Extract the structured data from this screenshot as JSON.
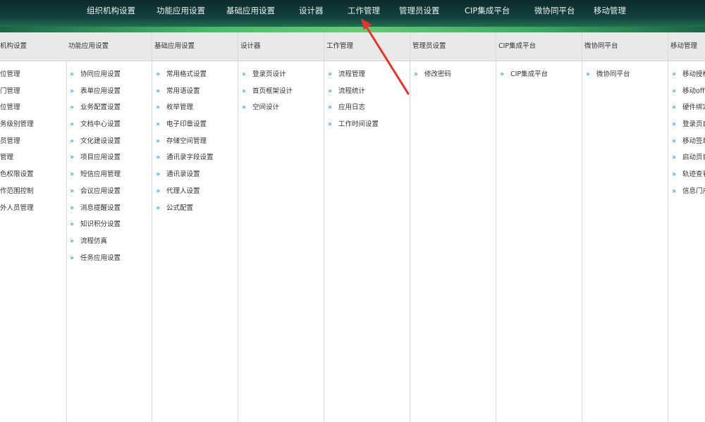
{
  "topnav": {
    "items": [
      "组织机构设置",
      "功能应用设置",
      "基础应用设置",
      "设计器",
      "工作管理",
      "管理员设置",
      "CIP集成平台",
      "微协同平台",
      "移动管理"
    ]
  },
  "columns": [
    {
      "title": "机构设置",
      "items": [
        "位管理",
        "门管理",
        "位管理",
        "务级别管理",
        "员管理",
        "管理",
        "色权限设置",
        "作范围控制",
        "外人员管理"
      ]
    },
    {
      "title": "功能应用设置",
      "items": [
        "协同应用设置",
        "表单应用设置",
        "业务配置设置",
        "文档中心设置",
        "文化建设设置",
        "项目应用设置",
        "短信应用管理",
        "会议应用设置",
        "消息提醒设置",
        "知识积分设置",
        "流程仿真",
        "任务应用设置"
      ]
    },
    {
      "title": "基础应用设置",
      "items": [
        "常用格式设置",
        "常用语设置",
        "枚举管理",
        "电子印章设置",
        "存储空间管理",
        "通讯录字段设置",
        "通讯录设置",
        "代理人设置",
        "公式配置"
      ]
    },
    {
      "title": "设计器",
      "items": [
        "登录页设计",
        "首页框架设计",
        "空间设计"
      ]
    },
    {
      "title": "工作管理",
      "items": [
        "流程管理",
        "流程统计",
        "应用日志",
        "工作时间设置"
      ]
    },
    {
      "title": "管理员设置",
      "items": [
        "修改密码"
      ]
    },
    {
      "title": "CIP集成平台",
      "items": [
        "CIP集成平台"
      ]
    },
    {
      "title": "微协同平台",
      "items": [
        "微协同平台"
      ]
    },
    {
      "title": "移动管理",
      "items": [
        "移动授权",
        "移动offi",
        "硬件绑定",
        "登录页自",
        "移动签章",
        "启动页自",
        "轨迹查看",
        "信息门户"
      ]
    }
  ],
  "arrow_glyph": "»",
  "colors": {
    "accent_arrow": "#1a8fd8",
    "annotation": "#e8322a",
    "header_bg": "#e9e9e9"
  }
}
